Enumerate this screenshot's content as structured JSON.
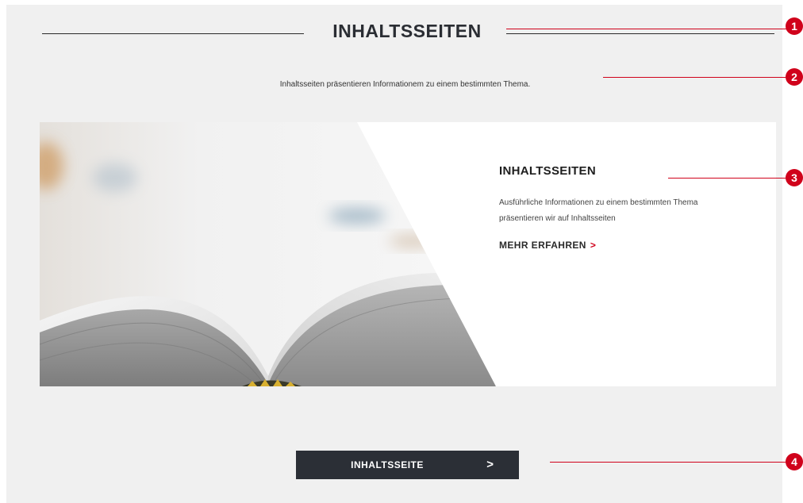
{
  "section": {
    "title": "INHALTSSEITEN",
    "intro": "Inhaltsseiten präsentieren Informationem zu einem bestimmten Thema."
  },
  "teaser": {
    "title": "INHALTSSEITEN",
    "text": "Ausführliche Informationen zu einem bestimmten Thema präsentieren wir auf Inhaltsseiten",
    "link_label": "MEHR ERFAHREN",
    "link_chevron": ">",
    "image_icon": "open-book-photo"
  },
  "cta": {
    "label": "INHALTSSEITE",
    "chevron": ">"
  },
  "callouts": [
    "1",
    "2",
    "3",
    "4"
  ],
  "colors": {
    "accent": "#d0021b",
    "button_bg": "#2b2f36",
    "page_bg": "#f0f0f0"
  }
}
